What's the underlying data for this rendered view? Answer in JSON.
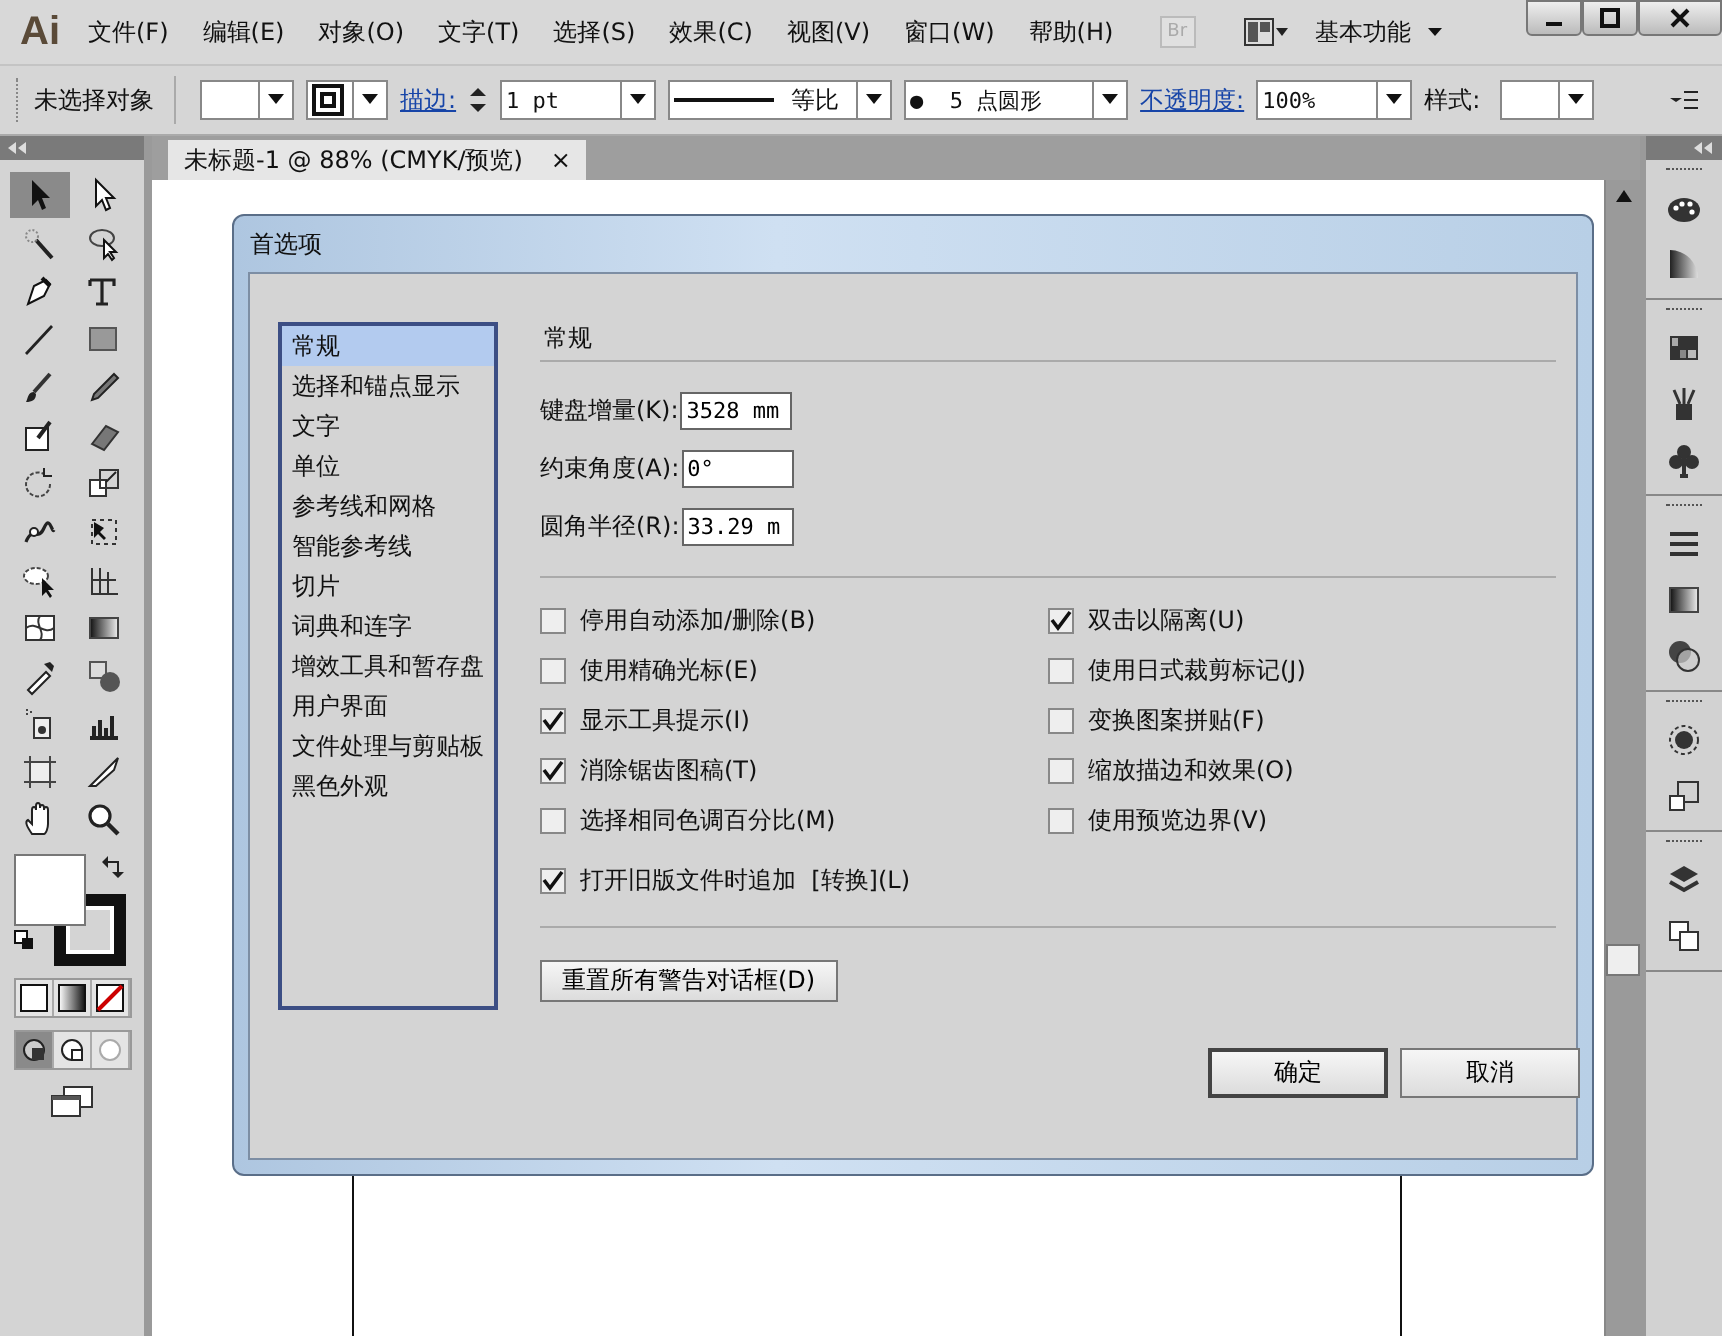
{
  "app": {
    "logo": "Ai",
    "menus": [
      "文件(F)",
      "编辑(E)",
      "对象(O)",
      "文字(T)",
      "选择(S)",
      "效果(C)",
      "视图(V)",
      "窗口(W)",
      "帮助(H)"
    ],
    "bridge": "Br",
    "workspace": "基本功能"
  },
  "control_bar": {
    "selection": "未选择对象",
    "stroke_link": "描边:",
    "stroke_weight": "1 pt",
    "profile": "等比",
    "brush": "●  5 点圆形",
    "opacity_link": "不透明度:",
    "opacity": "100%",
    "style_label": "样式:"
  },
  "document_tab": {
    "title": "未标题-1 @ 88% (CMYK/预览)",
    "close": "×"
  },
  "tools": [
    {
      "selected": true
    },
    {
      "selected": false
    },
    {
      "selected": false
    },
    {
      "selected": false
    },
    {
      "selected": false
    },
    {
      "selected": false
    },
    {
      "selected": false
    },
    {
      "selected": false
    },
    {
      "selected": false
    },
    {
      "selected": false
    },
    {
      "selected": false
    },
    {
      "selected": false
    },
    {
      "selected": false
    },
    {
      "selected": false
    },
    {
      "selected": false
    },
    {
      "selected": false
    },
    {
      "selected": false
    },
    {
      "selected": false
    },
    {
      "selected": false
    },
    {
      "selected": false
    },
    {
      "selected": false
    },
    {
      "selected": false
    },
    {
      "selected": false
    },
    {
      "selected": false
    },
    {
      "selected": false
    },
    {
      "selected": false
    },
    {
      "selected": false
    },
    {
      "selected": false
    }
  ],
  "dialog": {
    "title": "首选项",
    "categories": [
      {
        "label": "常规",
        "selected": true
      },
      {
        "label": "选择和锚点显示",
        "selected": false
      },
      {
        "label": "文字",
        "selected": false
      },
      {
        "label": "单位",
        "selected": false
      },
      {
        "label": "参考线和网格",
        "selected": false
      },
      {
        "label": "智能参考线",
        "selected": false
      },
      {
        "label": "切片",
        "selected": false
      },
      {
        "label": "词典和连字",
        "selected": false
      },
      {
        "label": "增效工具和暂存盘",
        "selected": false
      },
      {
        "label": "用户界面",
        "selected": false
      },
      {
        "label": "文件处理与剪贴板",
        "selected": false
      },
      {
        "label": "黑色外观",
        "selected": false
      }
    ],
    "section_title": "常规",
    "fields": [
      {
        "label": "键盘增量(K):",
        "value": "3528 mm"
      },
      {
        "label": "约束角度(A):",
        "value": "0°"
      },
      {
        "label": "圆角半径(R):",
        "value": "33.29 m"
      }
    ],
    "options_left": [
      {
        "label": "停用自动添加/删除(B)",
        "checked": false
      },
      {
        "label": "使用精确光标(E)",
        "checked": false
      },
      {
        "label": "显示工具提示(I)",
        "checked": true
      },
      {
        "label": "消除锯齿图稿(T)",
        "checked": true
      },
      {
        "label": "选择相同色调百分比(M)",
        "checked": false
      }
    ],
    "options_right": [
      {
        "label": "双击以隔离(U)",
        "checked": true
      },
      {
        "label": "使用日式裁剪标记(J)",
        "checked": false
      },
      {
        "label": "变换图案拼贴(F)",
        "checked": false
      },
      {
        "label": "缩放描边和效果(O)",
        "checked": false
      },
      {
        "label": "使用预览边界(V)",
        "checked": false
      }
    ],
    "option_wide": {
      "label": "打开旧版文件时追加  [转换](L)",
      "checked": true
    },
    "reset_button": "重置所有警告对话框(D)",
    "buttons": [
      "确定",
      "取消"
    ]
  }
}
